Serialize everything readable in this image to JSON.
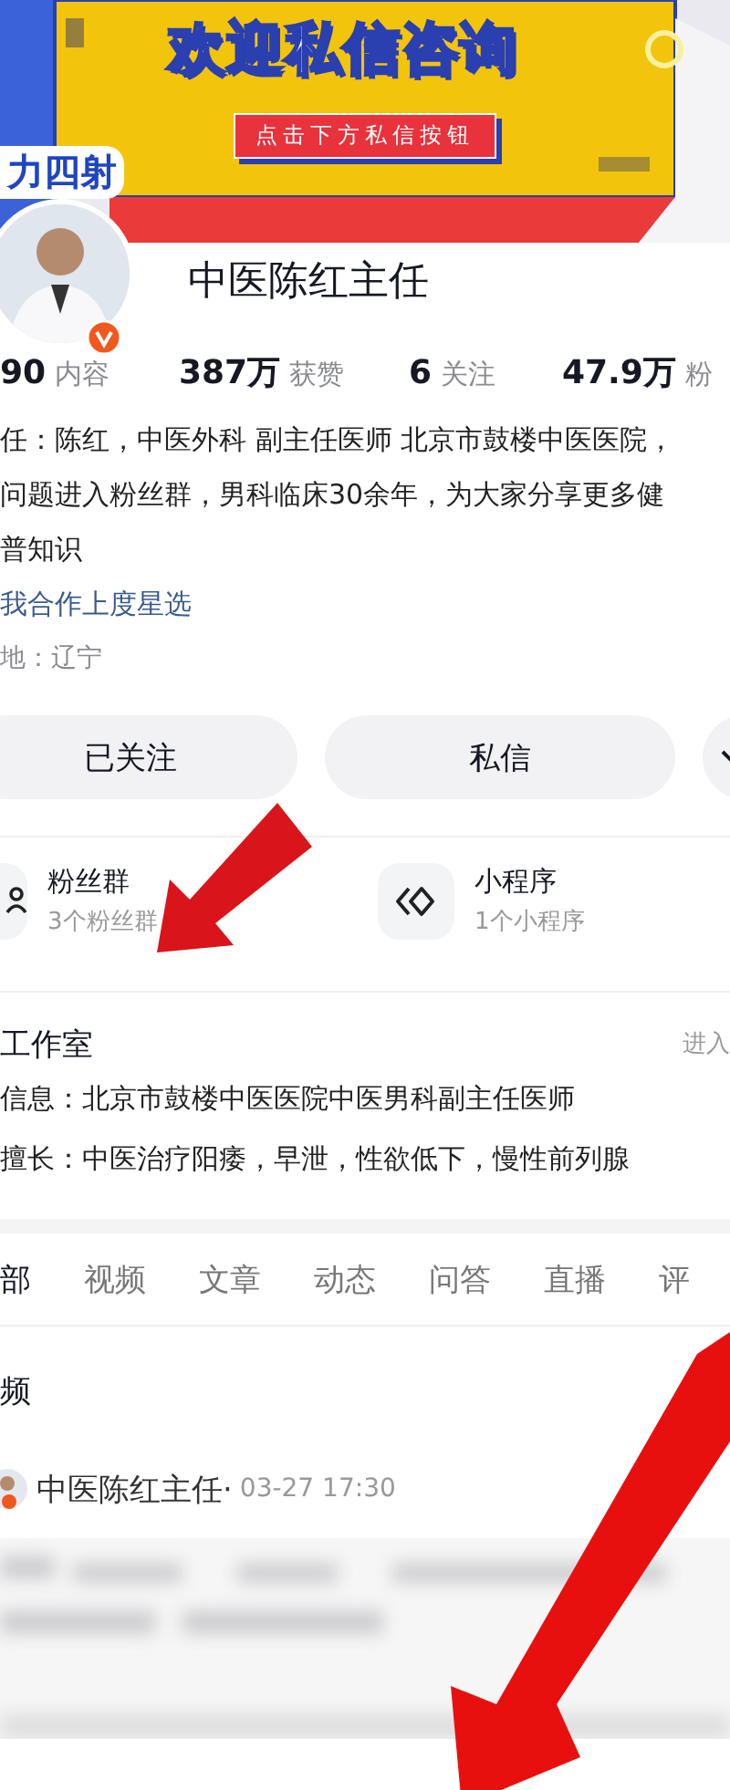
{
  "banner": {
    "kind": "picture",
    "headline": "欢迎私信咨询",
    "button": "点击下方私信按钮",
    "sticker": "力四射"
  },
  "profile": {
    "name": "中医陈红主任",
    "verified": true
  },
  "stats": [
    {
      "value": "90",
      "label": "内容"
    },
    {
      "value": "387万",
      "label": "获赞"
    },
    {
      "value": "6",
      "label": "关注"
    },
    {
      "value": "47.9万",
      "label": "粉"
    }
  ],
  "bio": [
    "任：陈红，中医外科 副主任医师 北京市鼓楼中医医院，",
    "问题进入粉丝群，男科临床30余年，为大家分享更多健",
    "普知识"
  ],
  "link": "我合作上度星选",
  "location": "地：辽宁",
  "actions": [
    {
      "kind": "text",
      "label": "已关注"
    },
    {
      "kind": "text",
      "label": "私信"
    },
    {
      "kind": "more"
    }
  ],
  "features": [
    {
      "kind": "group",
      "title": "粉丝群",
      "subtitle": "3个粉丝群"
    },
    {
      "kind": "miniapp",
      "title": "小程序",
      "subtitle": "1个小程序"
    }
  ],
  "studio": {
    "title": "工作室",
    "enter": "进入",
    "lines": [
      "信息：北京市鼓楼中医医院中医男科副主任医师",
      "擅长：中医治疗阳痿，早泄，性欲低下，慢性前列腺"
    ]
  },
  "tabs": [
    {
      "label": "部",
      "selected": true
    },
    {
      "label": "视频",
      "selected": false
    },
    {
      "label": "文章",
      "selected": false
    },
    {
      "label": "动态",
      "selected": false
    },
    {
      "label": "问答",
      "selected": false
    },
    {
      "label": "直播",
      "selected": false
    },
    {
      "label": "评",
      "selected": false
    }
  ],
  "section_title": "频",
  "post": {
    "author": "中医陈红主任·",
    "time": "03-27 17:30"
  }
}
